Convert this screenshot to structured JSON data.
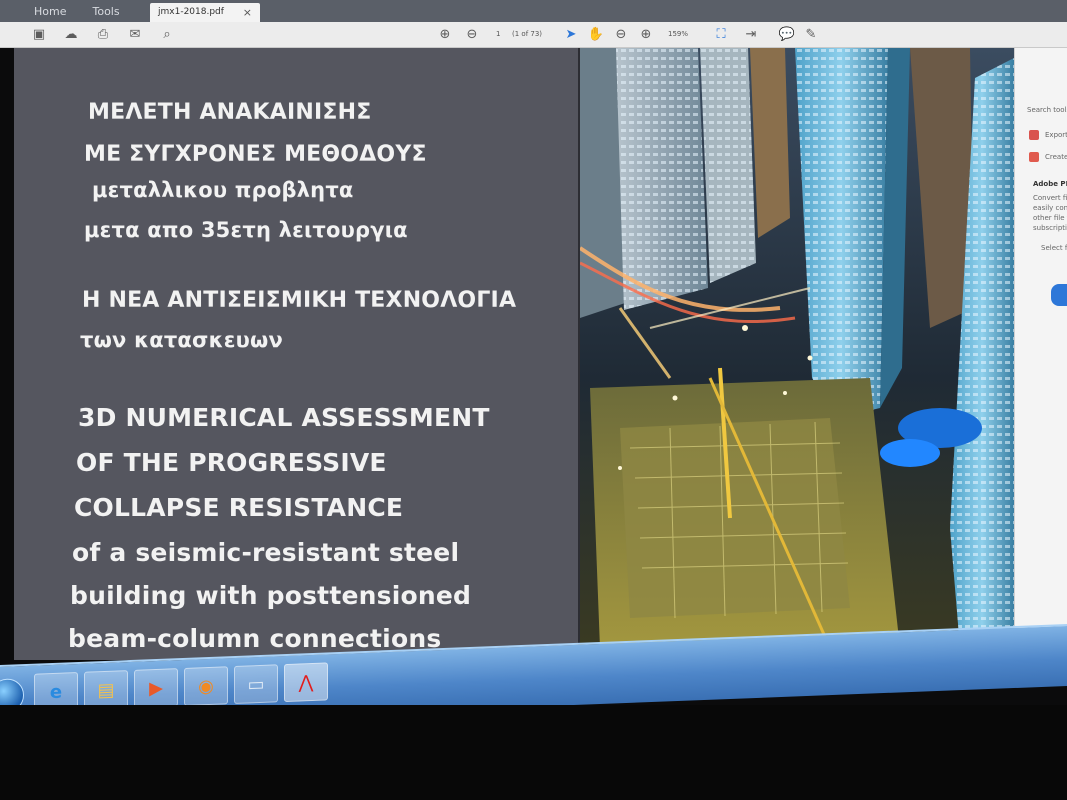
{
  "app": {
    "nav_tabs": [
      "Home",
      "Tools"
    ],
    "document_tab": "jmx1-2018.pdf",
    "page_number": "1",
    "page_of": "(1 of 73)",
    "zoom": "159%"
  },
  "document": {
    "greek_title_1": [
      "ΜΕΛΕΤΗ ΑΝΑΚΑΙΝΙΣΗΣ",
      "ΜΕ ΣΥΓΧΡΟΝΕΣ ΜΕΘΟΔΟΥΣ",
      "μεταλλικου προβλητα",
      "μετα απο 35ετη λειτουργια"
    ],
    "greek_title_2": [
      "Η ΝΕΑ ΑΝΤΙΣΕΙΣΜΙΚΗ ΤΕΧΝΟΛΟΓΙΑ",
      "των κατασκευων"
    ],
    "english_title": [
      "3D NUMERICAL ASSESSMENT",
      "OF THE PROGRESSIVE",
      "COLLAPSE RESISTANCE",
      "of a seismic-resistant steel",
      "building with posttensioned",
      "beam-column connections"
    ]
  },
  "right_pane": {
    "search": "Search tools",
    "export": "Export",
    "create": "Create",
    "adobe": "Adobe PDF",
    "desc_1": "Convert files",
    "desc_2": "easily conve",
    "desc_3": "other file fo",
    "desc_4": "subscription",
    "select": "Select fil"
  },
  "colors": {
    "panel": "#55565f",
    "text": "#f2f2f2",
    "taskbar": "#4e86c9",
    "toolbar": "#ececec"
  },
  "icons": [
    "save-icon",
    "upload-icon",
    "print-icon",
    "mail-icon",
    "zoom-icon",
    "prev-page-icon",
    "next-page-icon",
    "cursor-icon",
    "hand-icon",
    "zoom-out-icon",
    "zoom-in-icon",
    "fit-icon",
    "comment-icon",
    "pen-icon",
    "start-orb-icon",
    "ie-icon",
    "explorer-icon",
    "media-icon",
    "firefox-icon",
    "window-icon",
    "acrobat-icon"
  ]
}
